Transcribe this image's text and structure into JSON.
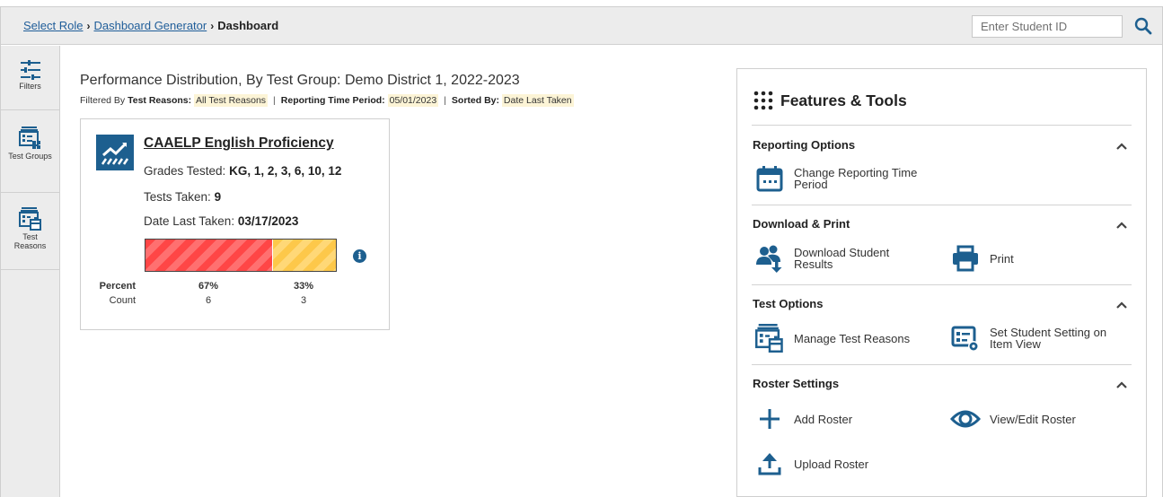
{
  "breadcrumb": {
    "items": [
      "Select Role",
      "Dashboard Generator"
    ],
    "current": "Dashboard",
    "separator": "›"
  },
  "search": {
    "placeholder": "Enter Student ID",
    "icon": "search-icon"
  },
  "leftnav": {
    "items": [
      {
        "label": "Filters",
        "icon": "filters-icon"
      },
      {
        "label": "Test Groups",
        "icon": "test-groups-icon"
      },
      {
        "label": "Test Reasons",
        "icon": "test-reasons-icon"
      }
    ]
  },
  "page": {
    "title": "Performance Distribution, By Test Group: Demo District 1, 2022-2023",
    "filter_prefix": "Filtered By",
    "filters": [
      {
        "label": "Test Reasons:",
        "value": "All Test Reasons"
      },
      {
        "label": "Reporting Time Period:",
        "value": "05/01/2023"
      },
      {
        "label": "Sorted By:",
        "value": "Date Last Taken"
      }
    ]
  },
  "card": {
    "title": "CAAELP English Proficiency",
    "grades_label": "Grades Tested:",
    "grades_value": "KG, 1, 2, 3, 6, 10, 12",
    "tests_label": "Tests Taken:",
    "tests_value": "9",
    "date_label": "Date Last Taken:",
    "date_value": "03/17/2023",
    "percent_label": "Percent",
    "count_label": "Count",
    "segments": [
      {
        "percent_text": "67%",
        "count": "6",
        "fraction": 0.67,
        "color": "#ff4646"
      },
      {
        "percent_text": "33%",
        "count": "3",
        "fraction": 0.33,
        "color": "#fdc84a"
      }
    ],
    "info_glyph": "i"
  },
  "tools": {
    "title": "Features & Tools",
    "sections": [
      {
        "title": "Reporting Options",
        "items": [
          {
            "label_1": "Change Reporting Time",
            "label_2": "Period",
            "icon": "calendar-icon"
          }
        ]
      },
      {
        "title": "Download & Print",
        "items": [
          {
            "label_1": "Download Student",
            "label_2": "Results",
            "icon": "download-students-icon"
          },
          {
            "label_1": "Print",
            "label_2": "",
            "icon": "printer-icon"
          }
        ]
      },
      {
        "title": "Test Options",
        "items": [
          {
            "label_1": "Manage Test Reasons",
            "label_2": "",
            "icon": "test-reasons-icon"
          },
          {
            "label_1": "Set Student Setting on",
            "label_2": "Item View",
            "icon": "student-setting-icon"
          }
        ]
      },
      {
        "title": "Roster Settings",
        "items": [
          {
            "label_1": "Add Roster",
            "label_2": "",
            "icon": "plus-icon"
          },
          {
            "label_1": "View/Edit Roster",
            "label_2": "",
            "icon": "eye-icon"
          },
          {
            "label_1": "Upload Roster",
            "label_2": "",
            "icon": "upload-icon"
          }
        ]
      }
    ]
  },
  "colors": {
    "brand": "#1d5f8f",
    "link": "#1f5d99",
    "highlight": "#fcf4d6"
  }
}
